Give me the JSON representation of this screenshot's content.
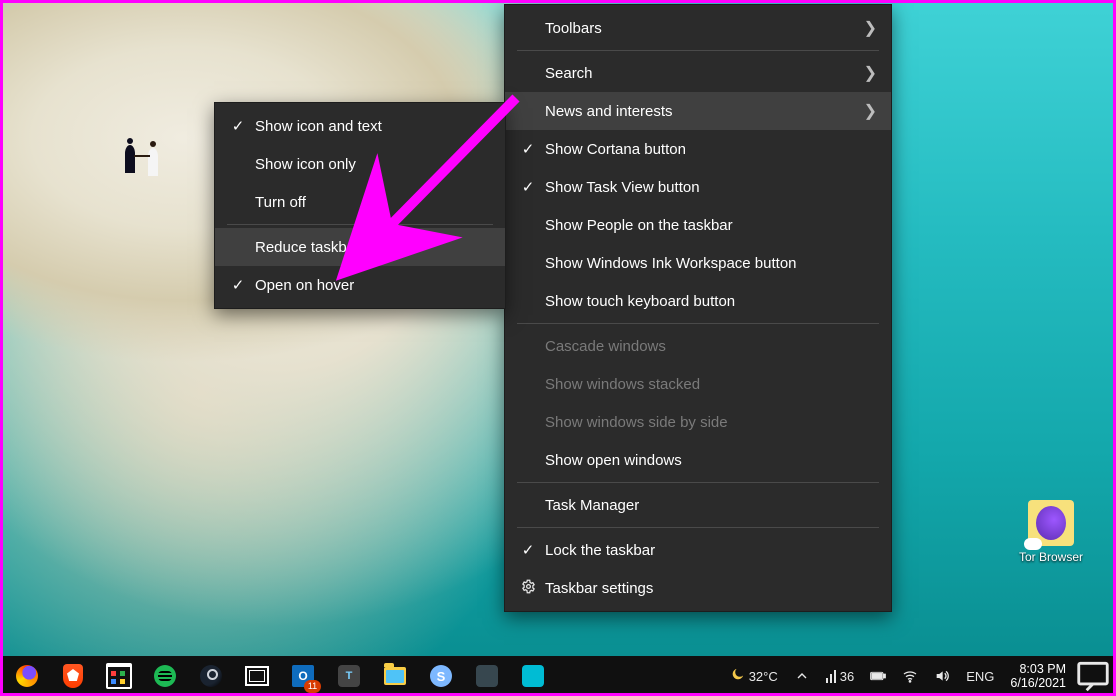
{
  "submenu": {
    "items": [
      {
        "label": "Show icon and text",
        "checked": true
      },
      {
        "label": "Show icon only",
        "checked": false
      },
      {
        "label": "Turn off",
        "checked": false
      }
    ],
    "reduce_label": "Reduce taskbar updates",
    "open_hover_label": "Open on hover",
    "open_hover_checked": true
  },
  "mainmenu": {
    "toolbars": "Toolbars",
    "search": "Search",
    "news": "News and interests",
    "cortana": {
      "label": "Show Cortana button",
      "checked": true
    },
    "taskview": {
      "label": "Show Task View button",
      "checked": true
    },
    "people": {
      "label": "Show People on the taskbar",
      "checked": false
    },
    "ink": {
      "label": "Show Windows Ink Workspace button",
      "checked": false
    },
    "touchkb": {
      "label": "Show touch keyboard button",
      "checked": false
    },
    "cascade": "Cascade windows",
    "stacked": "Show windows stacked",
    "sideby": "Show windows side by side",
    "openwin": "Show open windows",
    "taskmgr": "Task Manager",
    "lock": {
      "label": "Lock the taskbar",
      "checked": true
    },
    "settings": "Taskbar settings"
  },
  "desktop_icon": {
    "label": "Tor Browser"
  },
  "weather": {
    "temp1": "32°C",
    "temp2": "36"
  },
  "lang": "ENG",
  "clock": {
    "time": "8:03 PM",
    "date": "6/16/2021"
  },
  "outlook_badge": "11"
}
